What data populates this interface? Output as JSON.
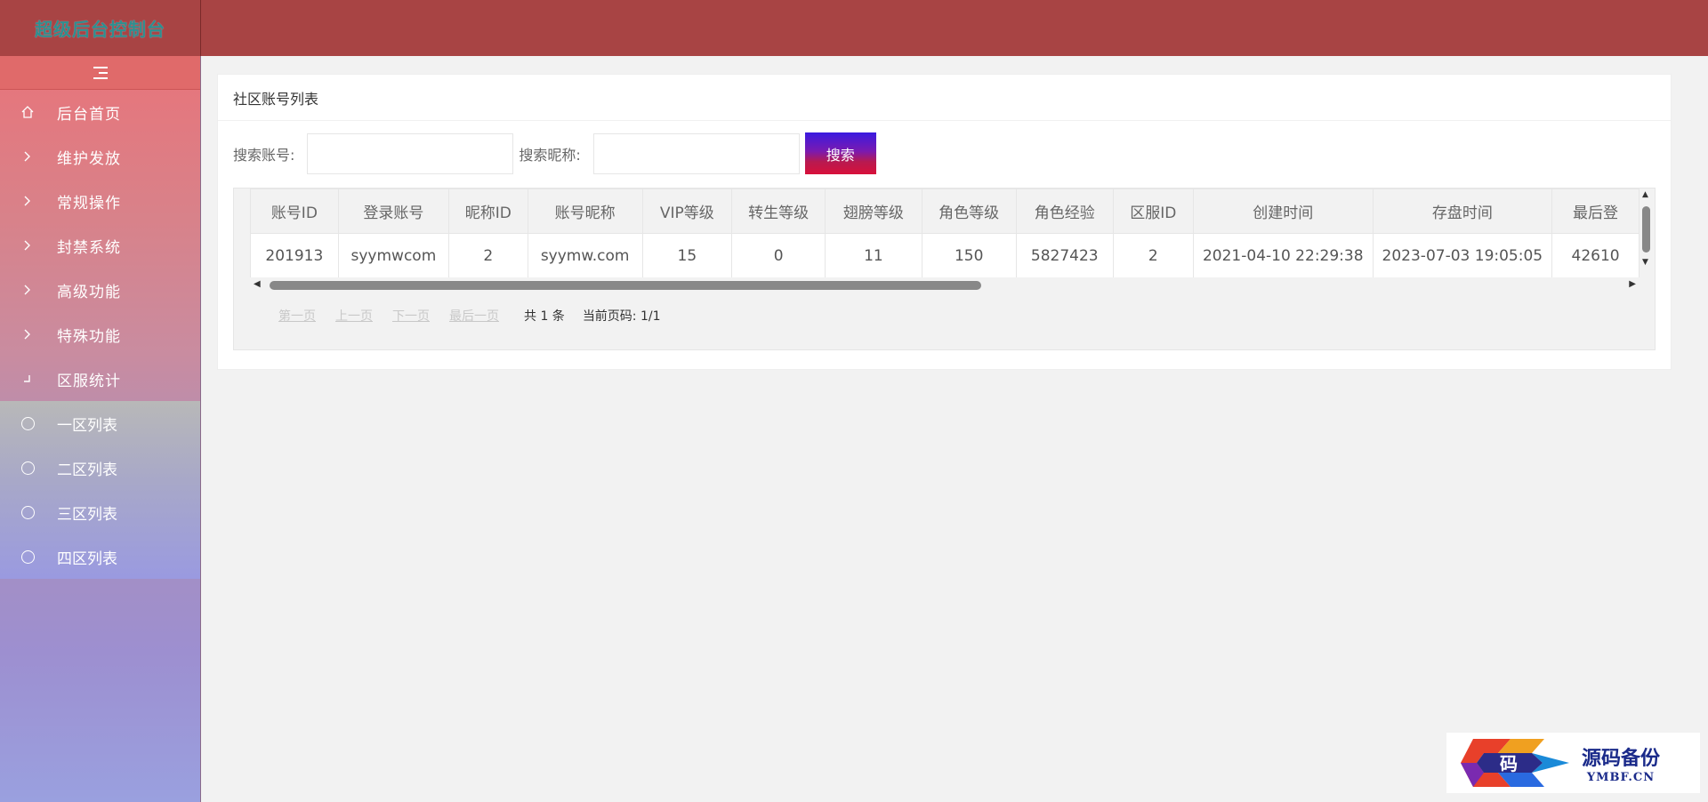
{
  "header": {
    "app_title": "超级后台控制台"
  },
  "sidebar": {
    "items": [
      {
        "label": "后台首页",
        "icon": "home-icon"
      },
      {
        "label": "维护发放",
        "icon": "chevron-right-icon"
      },
      {
        "label": "常规操作",
        "icon": "chevron-right-icon"
      },
      {
        "label": "封禁系统",
        "icon": "chevron-right-icon"
      },
      {
        "label": "高级功能",
        "icon": "chevron-right-icon"
      },
      {
        "label": "特殊功能",
        "icon": "chevron-right-icon"
      },
      {
        "label": "区服统计",
        "icon": "chevron-down-icon"
      }
    ],
    "sub_items": [
      {
        "label": "一区列表",
        "icon": "circle-icon"
      },
      {
        "label": "二区列表",
        "icon": "circle-icon"
      },
      {
        "label": "三区列表",
        "icon": "circle-icon"
      },
      {
        "label": "四区列表",
        "icon": "circle-icon"
      }
    ]
  },
  "card": {
    "title": "社区账号列表"
  },
  "search": {
    "account_label": "搜索账号:",
    "nickname_label": "搜索昵称:",
    "button_label": "搜索"
  },
  "table": {
    "headers": [
      "账号ID",
      "登录账号",
      "昵称ID",
      "账号昵称",
      "VIP等级",
      "转生等级",
      "翅膀等级",
      "角色等级",
      "角色经验",
      "区服ID",
      "创建时间",
      "存盘时间",
      "最后登"
    ],
    "rows": [
      [
        "201913",
        "syymwcom",
        "2",
        "syymw.com",
        "15",
        "0",
        "11",
        "150",
        "5827423",
        "2",
        "2021-04-10 22:29:38",
        "2023-07-03 19:05:05",
        "42610"
      ]
    ]
  },
  "pager": {
    "first": "第一页",
    "prev": "上一页",
    "next": "下一页",
    "last": "最后一页",
    "total": "共 1 条",
    "current": "当前页码: 1/1"
  },
  "watermark": {
    "cn": "源码备份",
    "en": "YMBF.CN",
    "logo_char": "码"
  },
  "colors": {
    "header": "#a84444",
    "sidebar_top": "#e8747a",
    "sidebar_bottom": "#9aa0df"
  }
}
